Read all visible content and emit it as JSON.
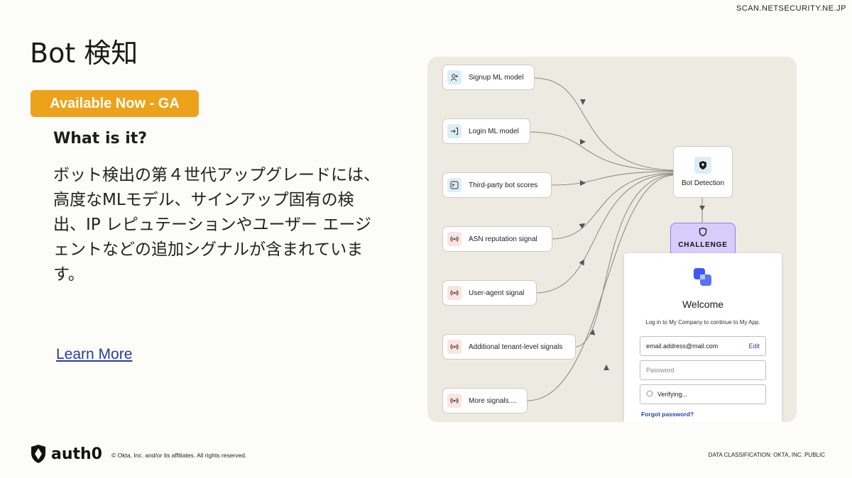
{
  "watermark": "SCAN.NETSECURITY.NE.JP",
  "slide": {
    "title": "Bot 検知",
    "badge": "Available Now - GA",
    "subheading": "What is it?",
    "body": "ボット検出の第４世代アップグレードには、高度なMLモデル、サインアップ固有の検出、IP レピュテーションやユーザー エージェントなどの追加シグナルが含まれています。",
    "link": "Learn More"
  },
  "diagram": {
    "signals": [
      {
        "label": "Signup ML model",
        "icon": "add-user-icon"
      },
      {
        "label": "Login ML model",
        "icon": "login-icon"
      },
      {
        "label": "Third-party bot scores",
        "icon": "third-party-icon"
      },
      {
        "label": "ASN reputation signal",
        "icon": "broadcast-icon"
      },
      {
        "label": "User-agent signal",
        "icon": "broadcast-icon"
      },
      {
        "label": "Additional tenant-level signals",
        "icon": "broadcast-icon"
      },
      {
        "label": "More signals....",
        "icon": "broadcast-icon"
      }
    ],
    "bot_detection": "Bot Detection",
    "challenge": "CHALLENGE",
    "login": {
      "welcome": "Welcome",
      "subtitle": "Log in to My Company to continue to My App.",
      "email_value": "email.address@mail.com",
      "edit": "Edit",
      "password_placeholder": "Password",
      "verifying": "Verifying...",
      "forgot": "Forgot password?"
    }
  },
  "footer": {
    "brand": "auth0",
    "copyright": "© Okta, Inc. and/or its affiliates. All rights reserved.",
    "classification": "DATA CLASSIFICATION: OKTA, INC. PUBLIC"
  },
  "colors": {
    "badge": "#eca21b",
    "link": "#2a3b9e",
    "challenge": "#d6cdfb",
    "panel": "#edeae2"
  }
}
